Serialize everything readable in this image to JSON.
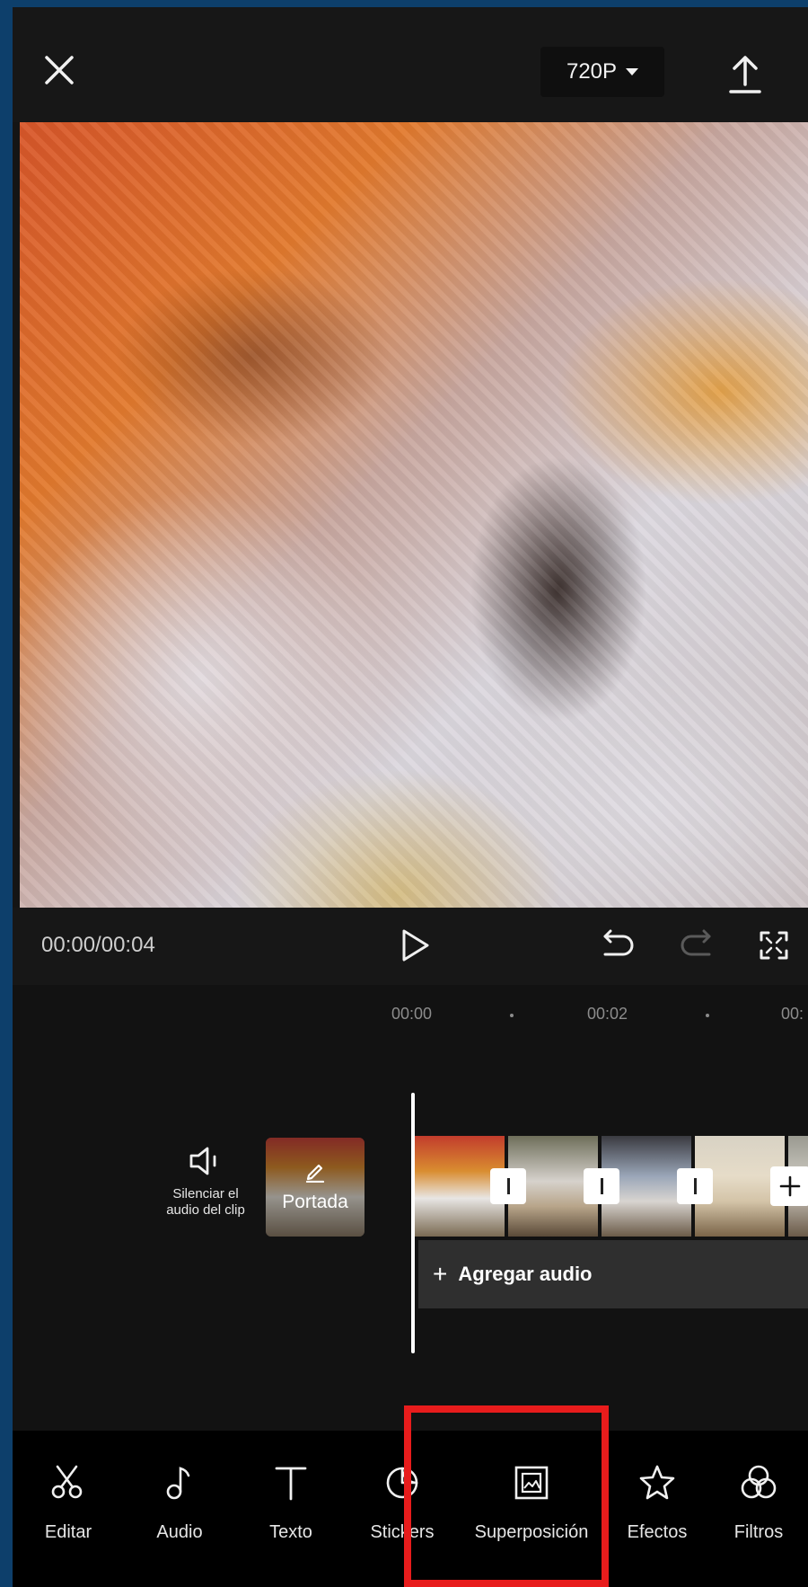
{
  "topbar": {
    "close_icon": "close-icon",
    "resolution": "720P",
    "resolution_icon": "caret-down-icon",
    "export_icon": "upload-icon"
  },
  "preview": {
    "content": "blurred motion video frame"
  },
  "playback": {
    "timecode": "00:00/00:04",
    "play_icon": "play-icon",
    "undo_icon": "undo-icon",
    "redo_icon": "redo-icon",
    "fullscreen_icon": "fullscreen-icon"
  },
  "timeline": {
    "ruler": [
      "00:00",
      "00:02",
      "00:"
    ],
    "mute_label": "Silenciar el\naudio del clip",
    "mute_icon": "speaker-icon",
    "cover_label": "Portada",
    "cover_icon": "pencil-icon",
    "add_clip_icon": "plus-icon",
    "audio_plus": "+",
    "audio_label": "Agregar audio"
  },
  "toolbar": {
    "items": [
      {
        "label": "Editar",
        "icon": "scissors-icon"
      },
      {
        "label": "Audio",
        "icon": "music-note-icon"
      },
      {
        "label": "Texto",
        "icon": "text-icon"
      },
      {
        "label": "Stickers",
        "icon": "sticker-icon"
      },
      {
        "label": "Superposición",
        "icon": "overlay-icon"
      },
      {
        "label": "Efectos",
        "icon": "effects-star-icon"
      },
      {
        "label": "Filtros",
        "icon": "filters-icon"
      }
    ]
  },
  "colors": {
    "background": "#0d3f6b",
    "app_bg": "#151515",
    "toolbar_bg": "#000000",
    "highlight": "#e81c1c",
    "audio_track": "#2f2f2f"
  }
}
